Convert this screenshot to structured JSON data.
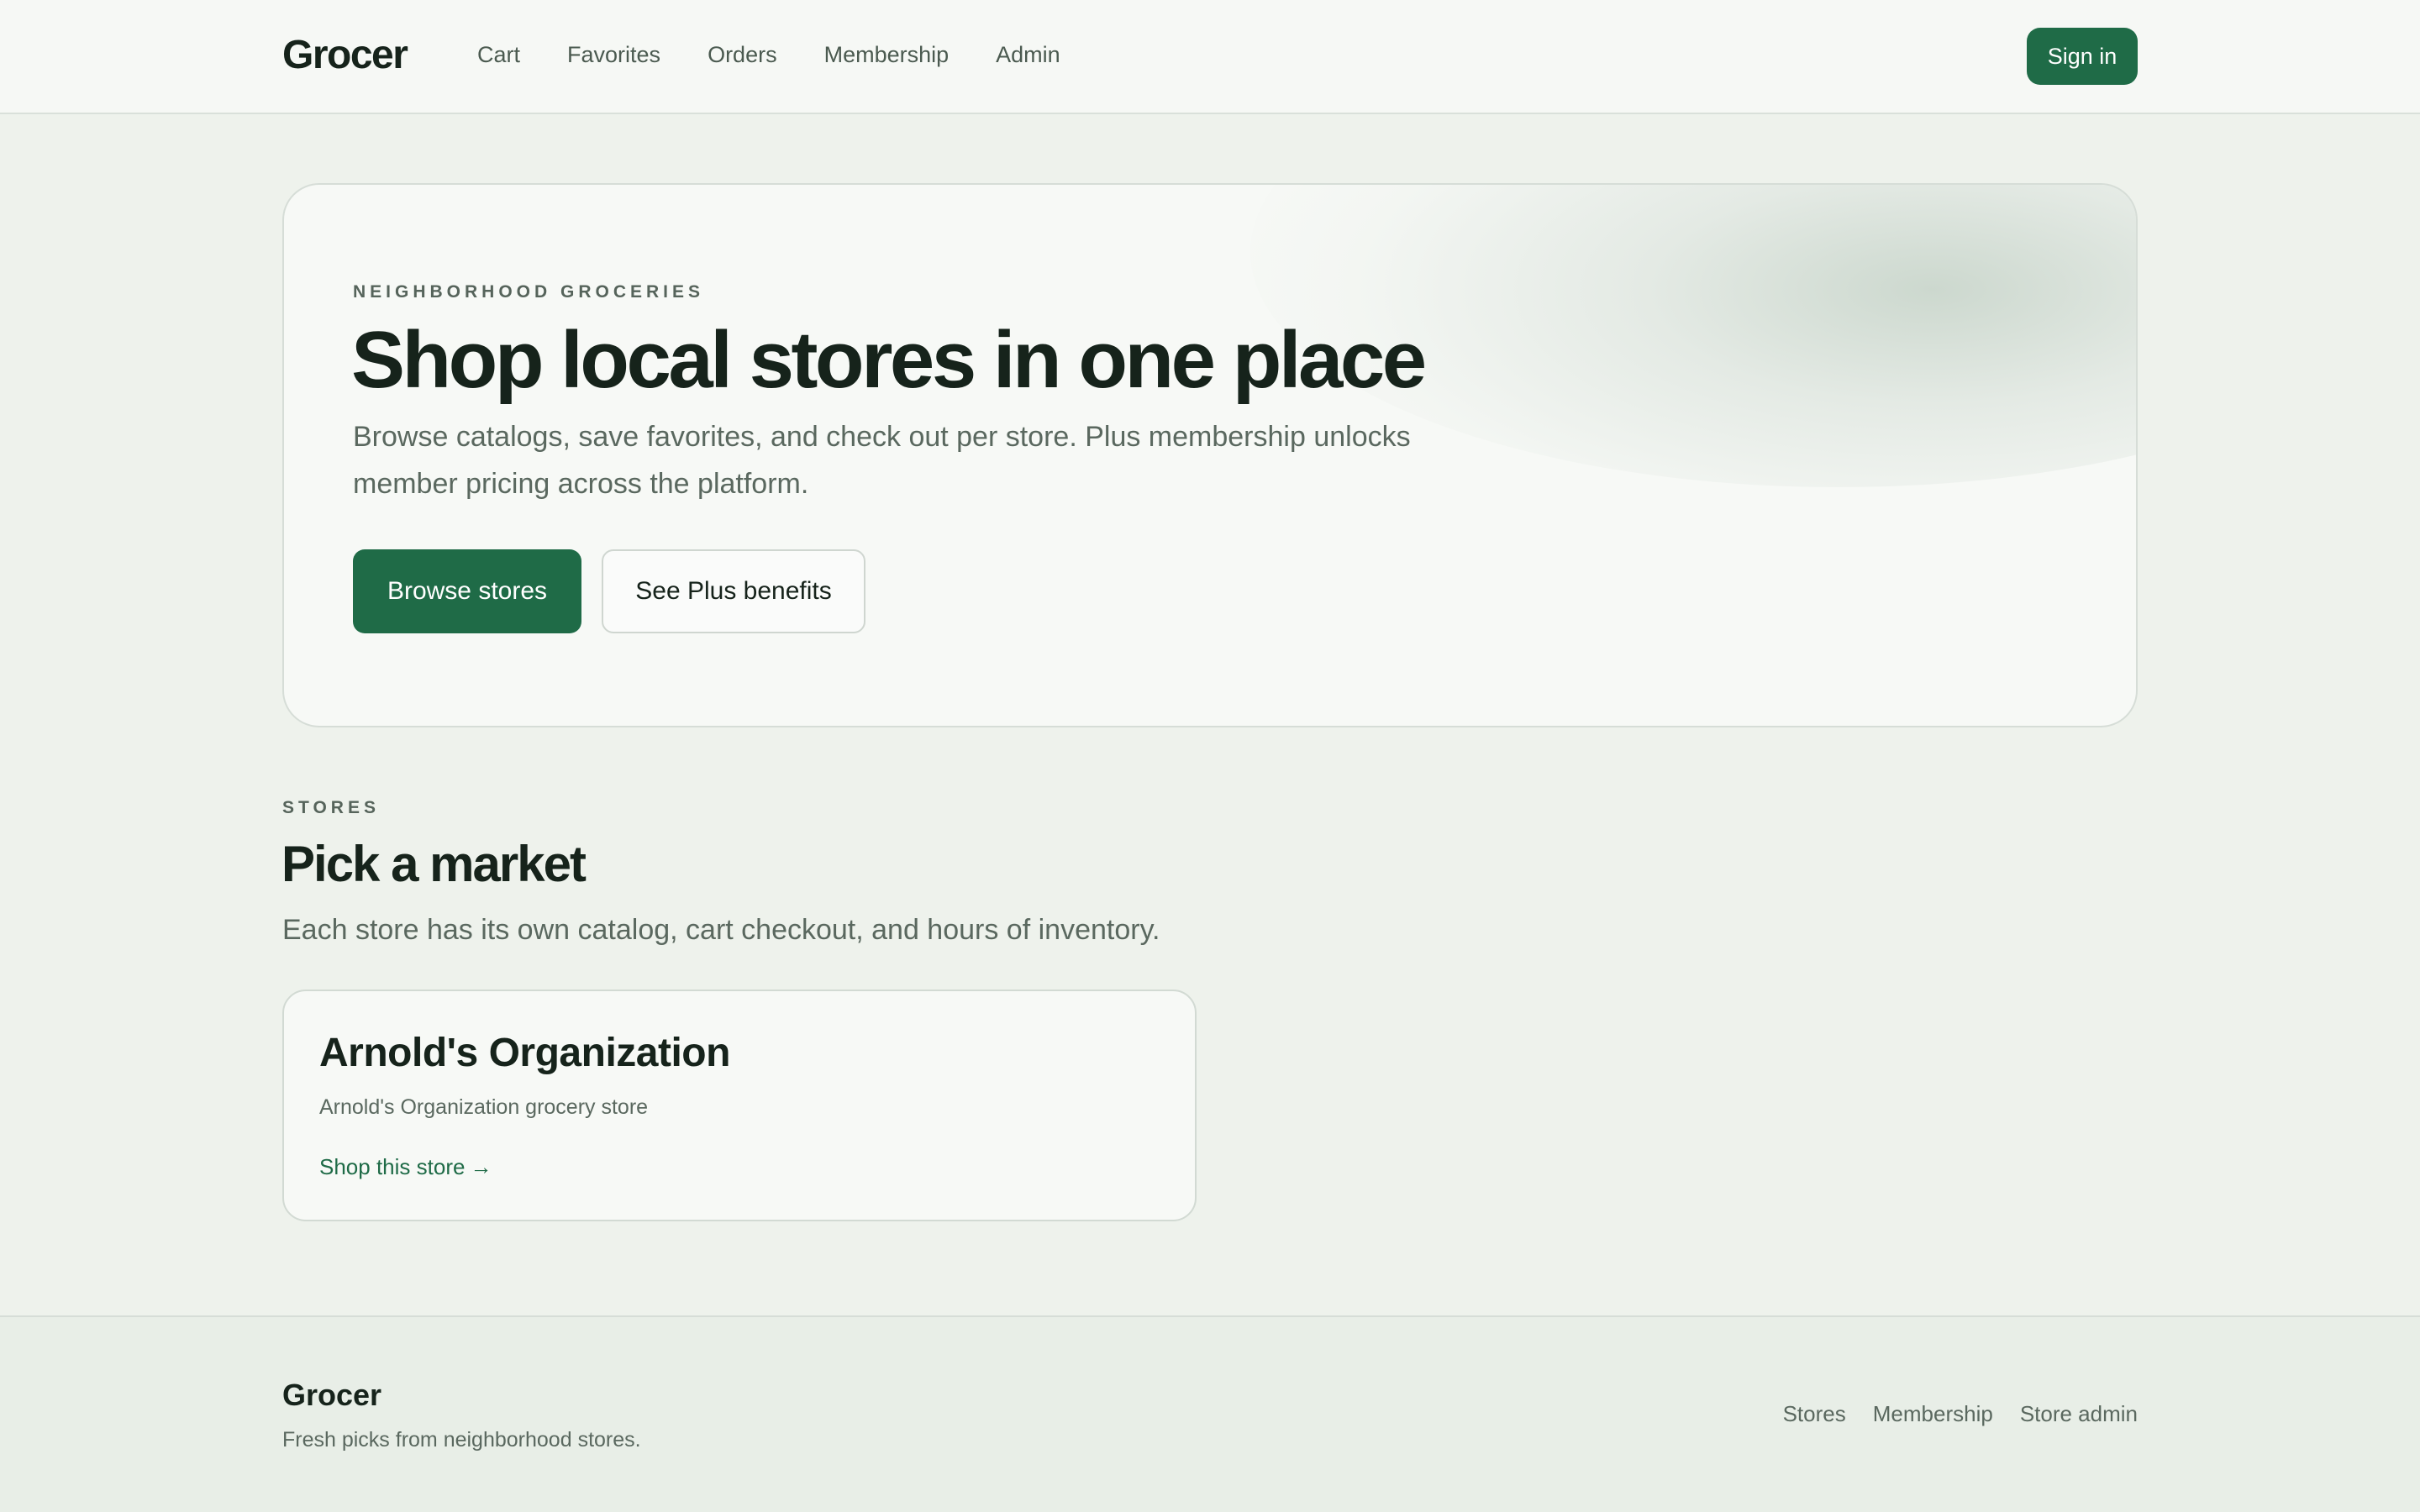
{
  "header": {
    "brand": "Grocer",
    "nav": [
      {
        "label": "Cart"
      },
      {
        "label": "Favorites"
      },
      {
        "label": "Orders"
      },
      {
        "label": "Membership"
      },
      {
        "label": "Admin"
      }
    ],
    "sign_in_label": "Sign in"
  },
  "hero": {
    "eyebrow": "NEIGHBORHOOD GROCERIES",
    "title": "Shop local stores in one place",
    "subtitle": "Browse catalogs, save favorites, and check out per store. Plus membership unlocks member pricing across the platform.",
    "primary_button": "Browse stores",
    "secondary_button": "See Plus benefits"
  },
  "stores": {
    "eyebrow": "STORES",
    "title": "Pick a market",
    "subtitle": "Each store has its own catalog, cart checkout, and hours of inventory.",
    "items": [
      {
        "name": "Arnold's Organization",
        "description": "Arnold's Organization grocery store",
        "link_label": "Shop this store",
        "link_icon": "→"
      }
    ]
  },
  "footer": {
    "brand": "Grocer",
    "tagline": "Fresh picks from neighborhood stores.",
    "links": [
      {
        "label": "Stores"
      },
      {
        "label": "Membership"
      },
      {
        "label": "Store admin"
      }
    ]
  },
  "colors": {
    "accent": "#1f6b47",
    "background": "#eef2ec",
    "text": "#16231b",
    "muted": "#5a685f"
  }
}
